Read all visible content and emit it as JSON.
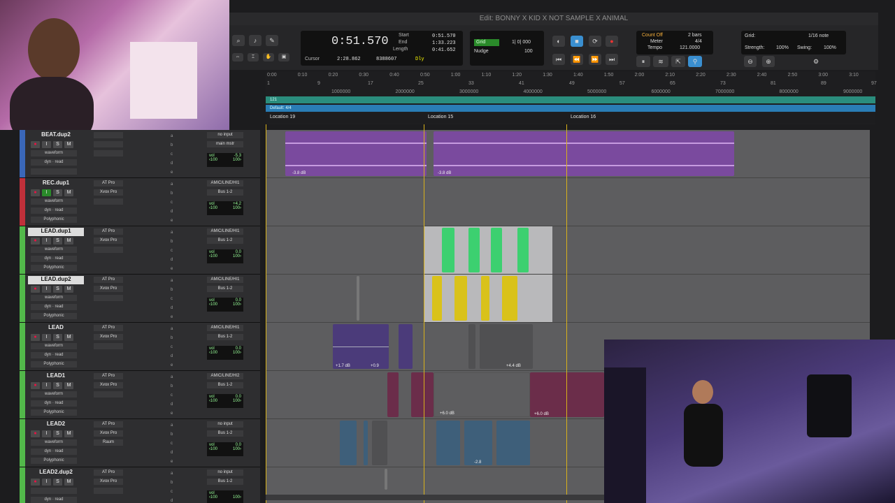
{
  "window_title": "Edit: BONNY X KID X NOT SAMPLE X ANIMAL",
  "counter": {
    "main": "0:51.570",
    "start_label": "Start",
    "end_label": "End",
    "length_label": "Length",
    "start": "0:51.570",
    "end": "1:33.223",
    "length": "0:41.652",
    "cursor_label": "Cursor",
    "cursor": "2:28.862",
    "samples": "8388607",
    "dly": "Dly"
  },
  "grid_nudge": {
    "grid_label": "Grid",
    "grid_value": "1| 0| 000",
    "nudge_label": "Nudge",
    "nudge_value": "100"
  },
  "metronome": {
    "count_off": "Count Off",
    "meter_label": "Meter",
    "tempo_label": "Tempo",
    "bars": "2 bars",
    "meter": "4/4",
    "tempo": "121.0000"
  },
  "grid_cfg": {
    "grid_label": "Grid:",
    "note": "1/16 note",
    "strength_label": "Strength:",
    "strength": "100%",
    "swing_label": "Swing:",
    "swing": "100%"
  },
  "ruler": {
    "minsecs": [
      "0:00",
      "0:10",
      "0:20",
      "0:30",
      "0:40",
      "0:50",
      "1:00",
      "1:10",
      "1:20",
      "1:30",
      "1:40",
      "1:50",
      "2:00",
      "2:10",
      "2:20",
      "2:30",
      "2:40",
      "2:50",
      "3:00",
      "3:10"
    ],
    "bars": [
      "1",
      "9",
      "17",
      "25",
      "33",
      "41",
      "49",
      "57",
      "65",
      "73",
      "81",
      "89",
      "97"
    ],
    "samples": [
      "1000000",
      "2000000",
      "3000000",
      "4000000",
      "5000000",
      "6000000",
      "7000000",
      "8000000",
      "9000000"
    ],
    "tempo_label": "121",
    "meter_label": "Default: 4/4",
    "markers": [
      "Location 19",
      "Location 15",
      "Location 16"
    ]
  },
  "tracks": [
    {
      "name": "BEAT.dup2",
      "color": "#3a67b8",
      "insert1": "",
      "insert2": "",
      "io_in": "no input",
      "io_out": "main mstr",
      "vol": "-5.3",
      "view": "waveform",
      "selected": false
    },
    {
      "name": "REC.dup1",
      "color": "#c0303a",
      "insert1": "AT Pro",
      "insert2": "Xvox Pro",
      "io_in": "AMIC/LINE/HI1",
      "io_out": "Bus 1-2",
      "vol": "+4.2",
      "view": "waveform",
      "selected": false,
      "algo": "Polyphonic"
    },
    {
      "name": "LEAD.dup1",
      "color": "#52b84a",
      "insert1": "AT Pro",
      "insert2": "Xvox Pro",
      "io_in": "AMIC/LINE/HI1",
      "io_out": "Bus 1-2",
      "vol": "0.0",
      "view": "waveform",
      "selected": true,
      "algo": "Polyphonic"
    },
    {
      "name": "LEAD.dup2",
      "color": "#52b84a",
      "insert1": "AT Pro",
      "insert2": "Xvox Pro",
      "io_in": "AMIC/LINE/HI1",
      "io_out": "Bus 1-2",
      "vol": "0.0",
      "view": "waveform",
      "selected": true,
      "algo": "Polyphonic"
    },
    {
      "name": "LEAD",
      "color": "#52b84a",
      "insert1": "AT Pro",
      "insert2": "Xvox Pro",
      "io_in": "AMIC/LINE/HI1",
      "io_out": "Bus 1-2",
      "vol": "0.0",
      "view": "waveform",
      "selected": false,
      "algo": "Polyphonic"
    },
    {
      "name": "LEAD1",
      "color": "#52b84a",
      "insert1": "AT Pro",
      "insert2": "Xvox Pro",
      "io_in": "AMIC/LINE/HI2",
      "io_out": "Bus 1-2",
      "vol": "0.0",
      "view": "waveform",
      "selected": false,
      "algo": "Polyphonic"
    },
    {
      "name": "LEAD2",
      "color": "#52b84a",
      "insert1": "AT Pro",
      "insert2": "Xvox Pro",
      "insert3": "Raum",
      "io_in": "no input",
      "io_out": "Bus 1-2",
      "vol": "0.0",
      "view": "waveform",
      "selected": false,
      "algo": "Polyphonic"
    },
    {
      "name": "LEAD2.dup2",
      "color": "#52b84a",
      "insert1": "AT Pro",
      "insert2": "Xvox Pro",
      "io_in": "no input",
      "io_out": "Bus 1-2",
      "vol": "",
      "view": "",
      "selected": false
    }
  ],
  "track_common": {
    "dyn": "dyn",
    "read": "read",
    "vol_label": "vol",
    "pan": "‹100",
    "pan2": "100›"
  },
  "clip_labels": {
    "beat_a": "-3.8 dB",
    "beat_b": "-3.8 dB",
    "lead_a": "+1.7 dB",
    "lead_b": "+0.9",
    "lead_c": "+4.4 dB",
    "lead1_a": "+6.0 dB",
    "lead1_b": "+6.0 dB",
    "lead2_a": "-2.8"
  },
  "colors": {
    "beat": "#7a4a9e",
    "green": "#3cd070",
    "yellow": "#d9c21a",
    "blue": "#3e5f7a",
    "maroon": "#6b2d4a",
    "selection": "#b9b9bb"
  }
}
